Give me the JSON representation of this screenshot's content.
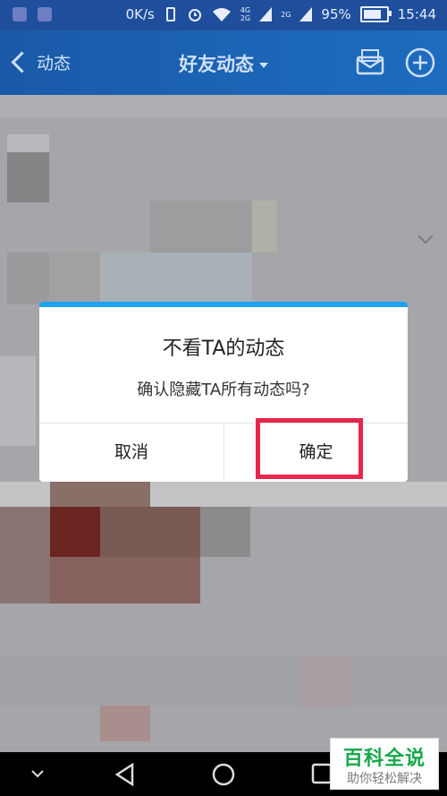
{
  "status_bar": {
    "network_speed": "0K/s",
    "network_4g": "4G",
    "network_2g": "2G",
    "network_2g_b": "2G",
    "battery_percent": "95%",
    "battery_level": 0.95,
    "time": "15:44"
  },
  "header": {
    "back_label": "动态",
    "title": "好友动态",
    "mail_icon": "mail-icon",
    "add_icon": "plus-circle-icon"
  },
  "dialog": {
    "title": "不看TA的动态",
    "message": "确认隐藏TA所有动态吗?",
    "cancel_label": "取消",
    "confirm_label": "确定"
  },
  "navigation": {
    "icons": [
      "chevron-down-icon",
      "back-triangle-icon",
      "home-circle-icon",
      "recents-square-icon"
    ]
  },
  "watermark": {
    "main": "百科全说",
    "sub": "助你轻松解决"
  },
  "colors": {
    "accent": "#1da1f2",
    "highlight": "#e8264d",
    "header": "#1d6cbf",
    "watermark_green": "#17a84a"
  }
}
